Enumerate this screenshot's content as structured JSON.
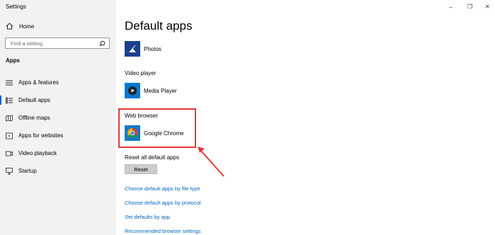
{
  "window": {
    "title": "Settings"
  },
  "controls": {
    "minimize": "–",
    "restore": "❐",
    "close": "✕"
  },
  "sidebar": {
    "home_label": "Home",
    "search_placeholder": "Find a setting",
    "section_label": "Apps",
    "items": [
      {
        "label": "Apps & features",
        "icon": "apps-features-icon"
      },
      {
        "label": "Default apps",
        "icon": "default-apps-icon",
        "active": true
      },
      {
        "label": "Offline maps",
        "icon": "offline-maps-icon"
      },
      {
        "label": "Apps for websites",
        "icon": "apps-for-websites-icon"
      },
      {
        "label": "Video playback",
        "icon": "video-playback-icon"
      },
      {
        "label": "Startup",
        "icon": "startup-icon"
      }
    ]
  },
  "main": {
    "title": "Default apps",
    "photo_viewer": {
      "app": "Photos"
    },
    "video_player": {
      "label": "Video player",
      "app": "Media Player"
    },
    "web_browser": {
      "label": "Web browser",
      "app": "Google Chrome"
    },
    "reset": {
      "label": "Reset all default apps",
      "button": "Reset"
    },
    "links": [
      "Choose default apps by file type",
      "Choose default apps by protocol",
      "Set defaults by app",
      "Recommended browser settings"
    ]
  },
  "colors": {
    "accent": "#0067c0",
    "annotation": "#e53935",
    "sidebar_bg": "#f2f2f2"
  }
}
